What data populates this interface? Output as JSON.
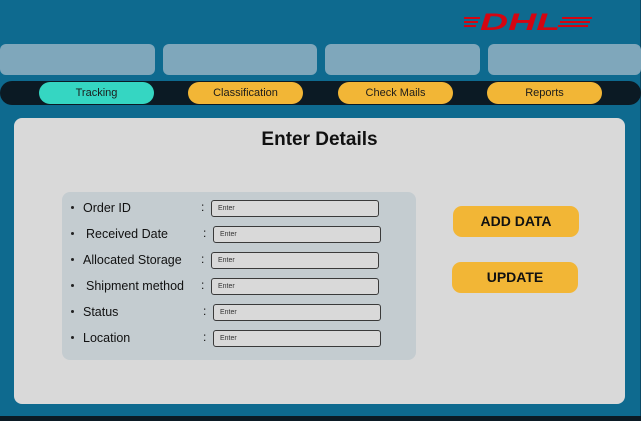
{
  "brand": {
    "logo_text": "DHL",
    "logo_color": "#d40511"
  },
  "colors": {
    "background": "#0e6a8f",
    "accent_active": "#35d6c2",
    "accent": "#f2b636"
  },
  "nav": {
    "tabs": [
      {
        "label": "Tracking",
        "active": true
      },
      {
        "label": "Classification",
        "active": false
      },
      {
        "label": "Check Mails",
        "active": false
      },
      {
        "label": "Reports",
        "active": false
      }
    ]
  },
  "main": {
    "title": "Enter Details",
    "fields": [
      {
        "label": "Order ID",
        "placeholder": "Enter"
      },
      {
        "label": "Received Date",
        "placeholder": "Enter"
      },
      {
        "label": "Allocated Storage",
        "placeholder": "Enter"
      },
      {
        "label": "Shipment method",
        "placeholder": "Enter"
      },
      {
        "label": "Status",
        "placeholder": "Enter"
      },
      {
        "label": "Location",
        "placeholder": "Enter"
      }
    ],
    "colon": ":",
    "add_button": "ADD DATA",
    "update_button": "UPDATE"
  }
}
